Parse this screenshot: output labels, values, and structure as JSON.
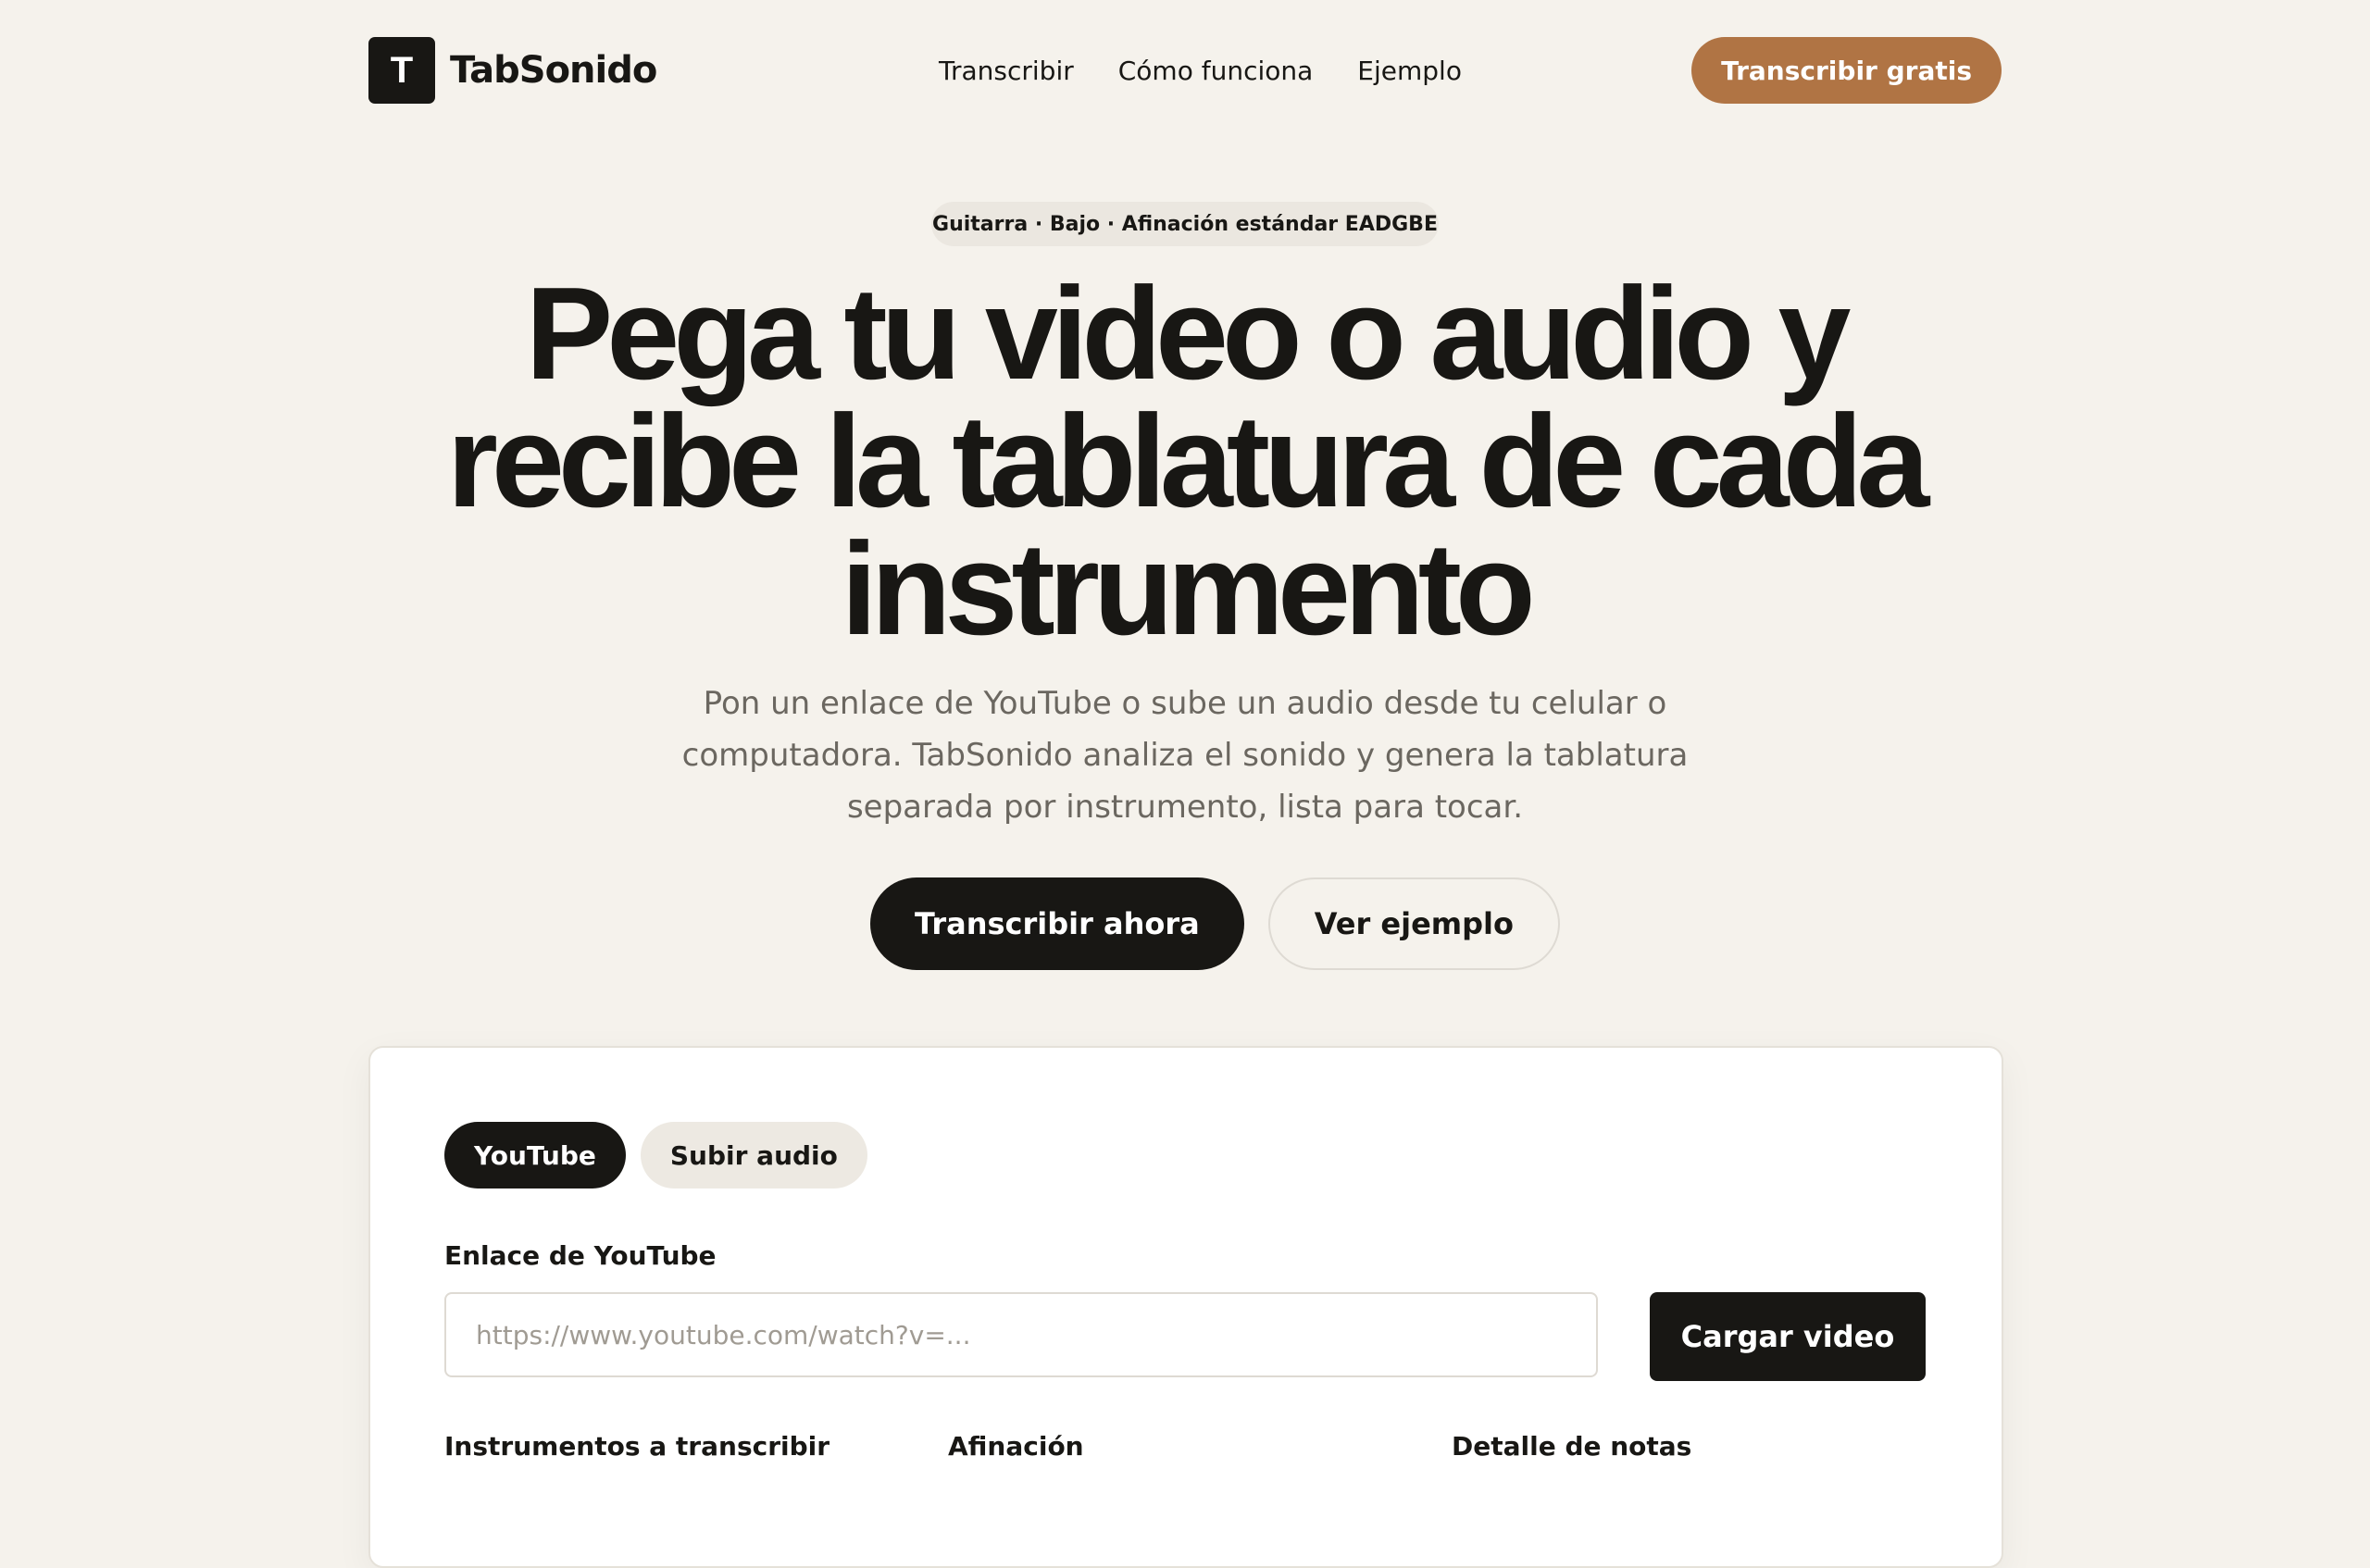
{
  "nav": {
    "brand_mark": "T",
    "brand_name": "TabSonido",
    "links": [
      "Transcribir",
      "Cómo funciona",
      "Ejemplo"
    ],
    "cta": "Transcribir gratis"
  },
  "hero": {
    "badge": "Guitarra · Bajo · Afinación estándar EADGBE",
    "title": "Pega tu video o audio y recibe la tablatura de cada instrumento",
    "subtitle": "Pon un enlace de YouTube o sube un audio desde tu celular o computadora. TabSonido analiza el sonido y genera la tablatura separada por instrumento, lista para tocar.",
    "primary_button": "Transcribir ahora",
    "secondary_button": "Ver ejemplo"
  },
  "card": {
    "tabs": [
      "YouTube",
      "Subir audio"
    ],
    "url_label": "Enlace de YouTube",
    "url_placeholder": "https://www.youtube.com/watch?v=...",
    "load_button": "Cargar video",
    "instruments_label": "Instrumentos a transcribir",
    "tuning_label": "Afinación",
    "detail_label": "Detalle de notas"
  },
  "colors": {
    "background": "#f5f2ec",
    "text": "#181714",
    "accent": "#b07444"
  }
}
